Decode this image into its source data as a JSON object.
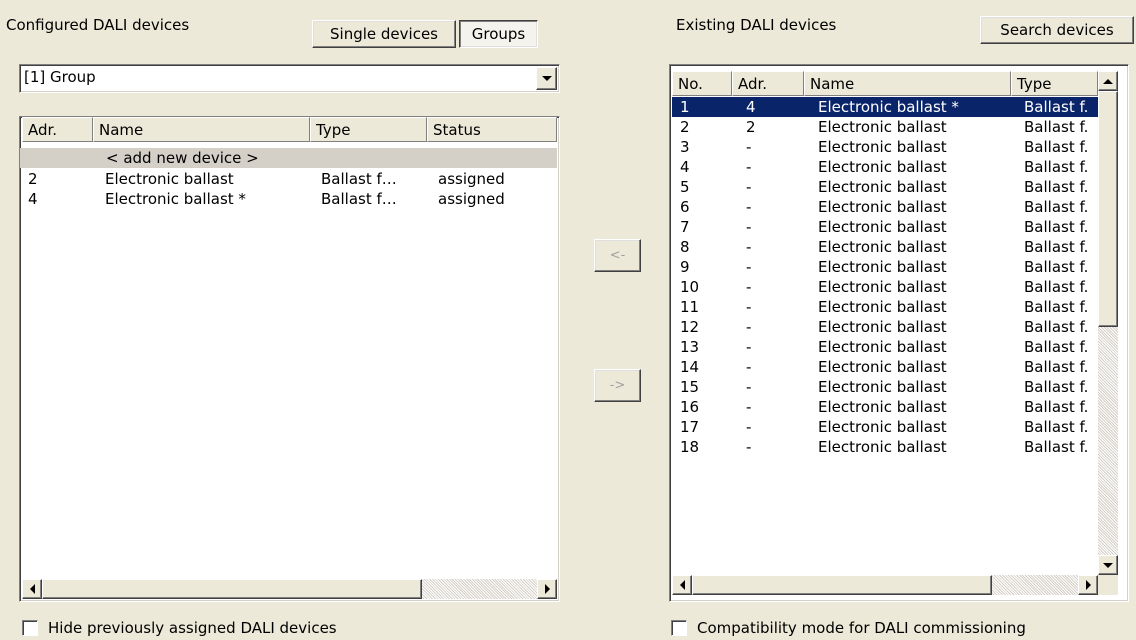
{
  "left_panel": {
    "title": "Configured DALI devices",
    "single_devices_label": "Single devices",
    "groups_label": "Groups",
    "group_select_value": "[1] Group",
    "columns": {
      "adr": "Adr.",
      "name": "Name",
      "type": "Type",
      "status": "Status"
    },
    "add_new_label": "< add new device >",
    "rows": [
      {
        "adr": "2",
        "name": "Electronic ballast",
        "type": "Ballast f…",
        "status": "assigned"
      },
      {
        "adr": "4",
        "name": "Electronic ballast *",
        "type": "Ballast f…",
        "status": "assigned"
      }
    ],
    "hide_assigned_label": "Hide previously assigned DALI devices"
  },
  "middle": {
    "move_left_label": "<-",
    "move_right_label": "->"
  },
  "right_panel": {
    "title": "Existing DALI devices",
    "search_label": "Search devices",
    "columns": {
      "no": "No.",
      "adr": "Adr.",
      "name": "Name",
      "type": "Type"
    },
    "rows": [
      {
        "no": "1",
        "adr": "4",
        "name": "Electronic ballast *",
        "type": "Ballast f."
      },
      {
        "no": "2",
        "adr": "2",
        "name": "Electronic ballast",
        "type": "Ballast f."
      },
      {
        "no": "3",
        "adr": "-",
        "name": "Electronic ballast",
        "type": "Ballast f."
      },
      {
        "no": "4",
        "adr": "-",
        "name": "Electronic ballast",
        "type": "Ballast f."
      },
      {
        "no": "5",
        "adr": "-",
        "name": "Electronic ballast",
        "type": "Ballast f."
      },
      {
        "no": "6",
        "adr": "-",
        "name": "Electronic ballast",
        "type": "Ballast f."
      },
      {
        "no": "7",
        "adr": "-",
        "name": "Electronic ballast",
        "type": "Ballast f."
      },
      {
        "no": "8",
        "adr": "-",
        "name": "Electronic ballast",
        "type": "Ballast f."
      },
      {
        "no": "9",
        "adr": "-",
        "name": "Electronic ballast",
        "type": "Ballast f."
      },
      {
        "no": "10",
        "adr": "-",
        "name": "Electronic ballast",
        "type": "Ballast f."
      },
      {
        "no": "11",
        "adr": "-",
        "name": "Electronic ballast",
        "type": "Ballast f."
      },
      {
        "no": "12",
        "adr": "-",
        "name": "Electronic ballast",
        "type": "Ballast f."
      },
      {
        "no": "13",
        "adr": "-",
        "name": "Electronic ballast",
        "type": "Ballast f."
      },
      {
        "no": "14",
        "adr": "-",
        "name": "Electronic ballast",
        "type": "Ballast f."
      },
      {
        "no": "15",
        "adr": "-",
        "name": "Electronic ballast",
        "type": "Ballast f."
      },
      {
        "no": "16",
        "adr": "-",
        "name": "Electronic ballast",
        "type": "Ballast f."
      },
      {
        "no": "17",
        "adr": "-",
        "name": "Electronic ballast",
        "type": "Ballast f."
      },
      {
        "no": "18",
        "adr": "-",
        "name": "Electronic ballast",
        "type": "Ballast f."
      }
    ],
    "selected_row_index": 0,
    "compat_mode_label": "Compatibility mode for DALI commissioning"
  },
  "colors": {
    "window_bg": "#ece9d8",
    "selection_bg": "#0a246a",
    "selection_text": "#ffffff"
  }
}
